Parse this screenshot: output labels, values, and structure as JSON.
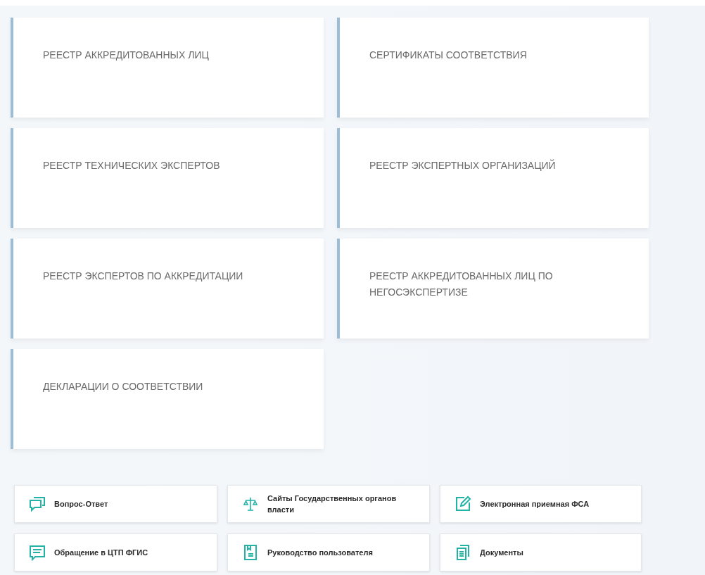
{
  "registries": [
    {
      "title": "РЕЕСТР АККРЕДИТОВАННЫХ ЛИЦ"
    },
    {
      "title": "СЕРТИФИКАТЫ СООТВЕТСТВИЯ"
    },
    {
      "title": "РЕЕСТР ТЕХНИЧЕСКИХ ЭКСПЕРТОВ"
    },
    {
      "title": "РЕЕСТР ЭКСПЕРТНЫХ ОРГАНИЗАЦИЙ"
    },
    {
      "title": "РЕЕСТР ЭКСПЕРТОВ ПО АККРЕДИТАЦИИ"
    },
    {
      "title": "РЕЕСТР АККРЕДИТОВАННЫХ ЛИЦ ПО НЕГОСЭКСПЕРТИЗЕ"
    },
    {
      "title": "ДЕКЛАРАЦИИ О СООТВЕТСТВИИ"
    }
  ],
  "links": [
    {
      "kind": "chat",
      "label": "Вопрос-Ответ"
    },
    {
      "kind": "scales",
      "label": "Сайты Государственных органов власти"
    },
    {
      "kind": "edit",
      "label": "Электронная приемная ФСА"
    },
    {
      "kind": "message",
      "label": "Обращение в ЦТП ФГИС"
    },
    {
      "kind": "manual",
      "label": "Руководство пользователя"
    },
    {
      "kind": "documents",
      "label": "Документы"
    }
  ]
}
